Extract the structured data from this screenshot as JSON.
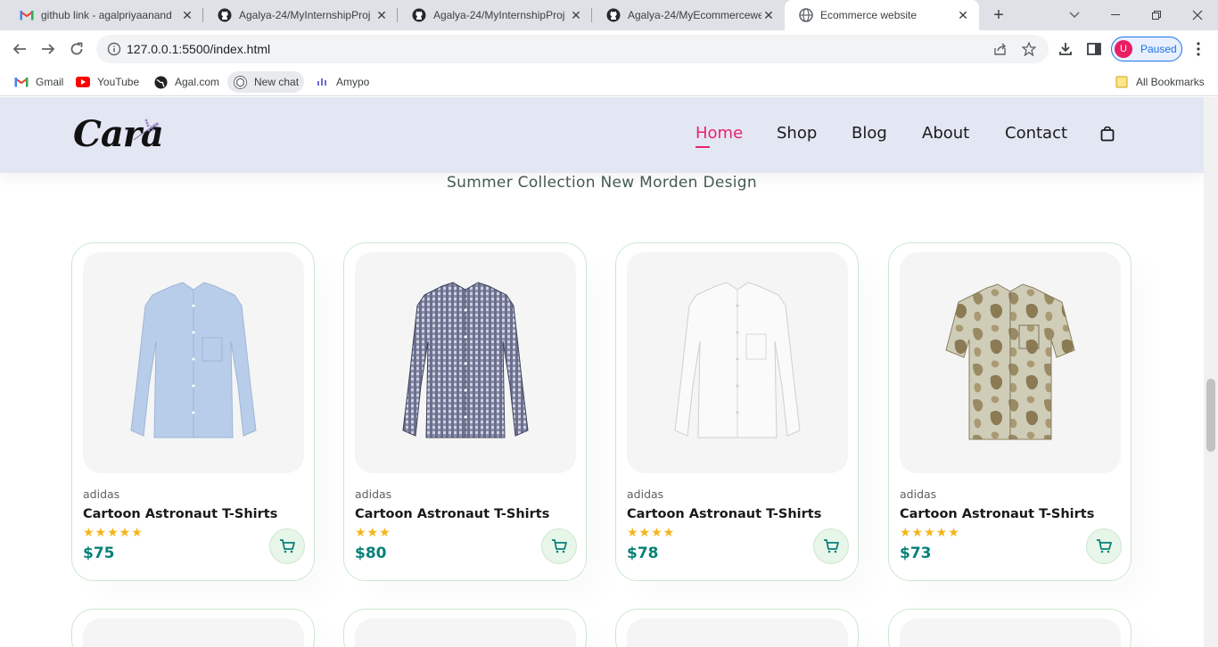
{
  "browser": {
    "tabs": [
      {
        "title": "github link - agalpriyaanand",
        "icon": "gmail-icon",
        "active": false
      },
      {
        "title": "Agalya-24/MyInternshipProj",
        "icon": "github-icon",
        "active": false
      },
      {
        "title": "Agalya-24/MyInternshipProj",
        "icon": "github-icon",
        "active": false
      },
      {
        "title": "Agalya-24/MyEcommercewe",
        "icon": "github-icon",
        "active": false
      },
      {
        "title": "Ecommerce website",
        "icon": "globe-icon",
        "active": true
      }
    ],
    "url": "127.0.0.1:5500/index.html",
    "profile_initial": "U",
    "profile_status": "Paused",
    "bookmarks": [
      {
        "label": "Gmail",
        "icon": "gmail-icon"
      },
      {
        "label": "YouTube",
        "icon": "youtube-icon"
      },
      {
        "label": "Agal.com",
        "icon": "globe-icon"
      },
      {
        "label": "New chat",
        "icon": "chatgpt-icon"
      },
      {
        "label": "Amypo",
        "icon": "amypo-icon"
      }
    ],
    "all_bookmarks": "All Bookmarks"
  },
  "site": {
    "logo": "Cara",
    "nav": [
      "Home",
      "Shop",
      "Blog",
      "About",
      "Contact"
    ],
    "active_nav": "Home",
    "subtitle": "Summer Collection New Morden Design",
    "accent_color": "#088178",
    "active_nav_color": "#e8246a"
  },
  "products": [
    {
      "brand": "adidas",
      "name": "Cartoon Astronaut T-Shirts",
      "rating": 5,
      "stars": "★★★★★",
      "price": "$75",
      "shirt": "light-blue-shirt"
    },
    {
      "brand": "adidas",
      "name": "Cartoon Astronaut T-Shirts",
      "rating": 3,
      "stars": "★★★",
      "price": "$80",
      "shirt": "gingham-shirt"
    },
    {
      "brand": "adidas",
      "name": "Cartoon Astronaut T-Shirts",
      "rating": 4,
      "stars": "★★★★",
      "price": "$78",
      "shirt": "white-shirt"
    },
    {
      "brand": "adidas",
      "name": "Cartoon Astronaut T-Shirts",
      "rating": 5,
      "stars": "★★★★★",
      "price": "$73",
      "shirt": "patterned-short-sleeve-shirt"
    }
  ]
}
